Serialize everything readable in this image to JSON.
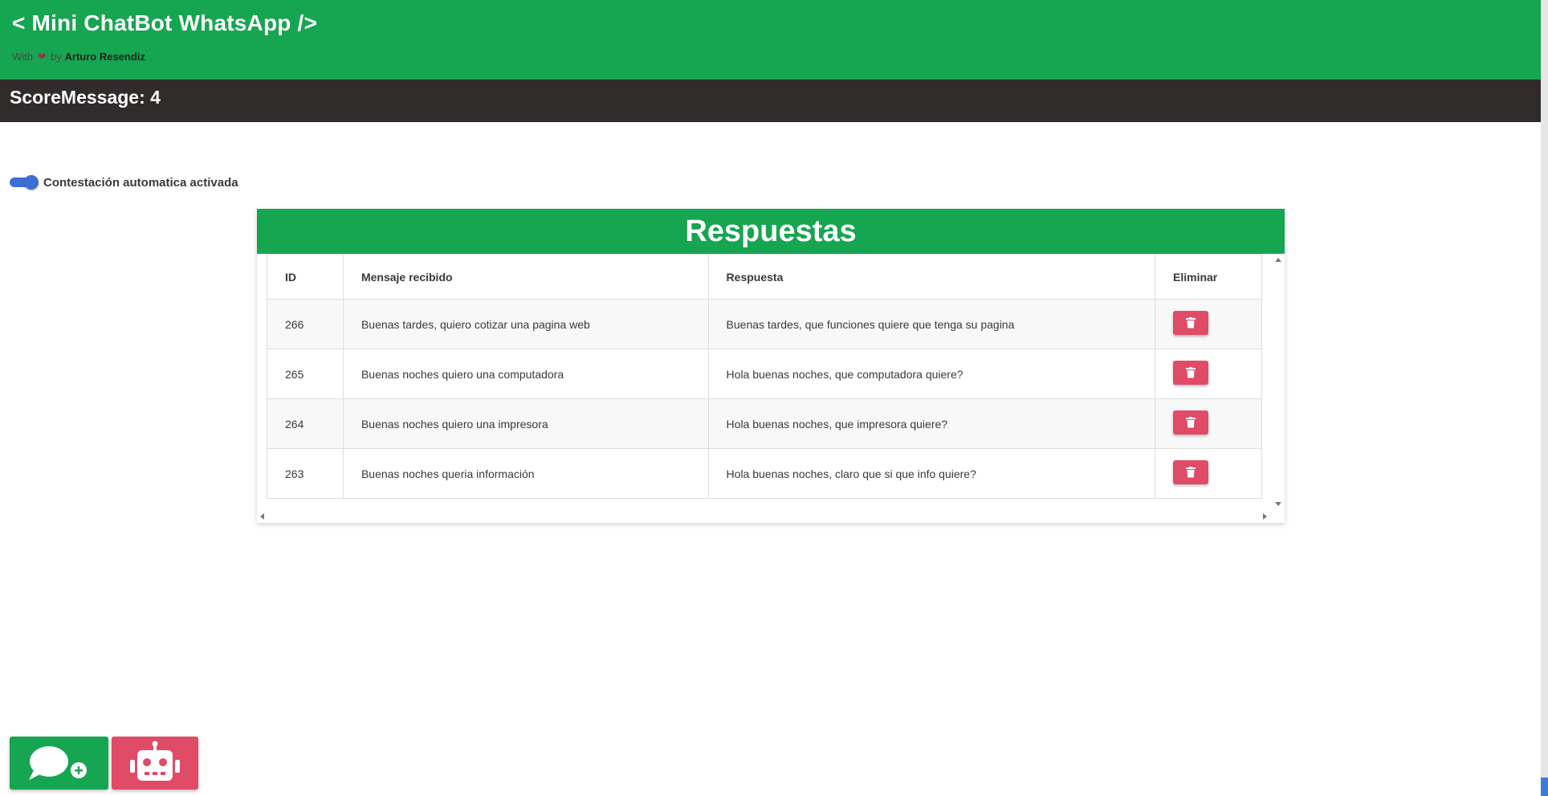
{
  "header": {
    "title": "< Mini ChatBot WhatsApp />",
    "credits_prefix": "With",
    "credits_middle": "by",
    "author": "Arturo Resendiz"
  },
  "score": {
    "text": "ScoreMessage: 4"
  },
  "auto_reply": {
    "label": "Contestación automatica activada",
    "enabled": true
  },
  "responses": {
    "title": "Respuestas",
    "columns": [
      "ID",
      "Mensaje recibido",
      "Respuesta",
      "Eliminar"
    ],
    "rows": [
      {
        "id": "266",
        "message": "Buenas tardes, quiero cotizar una pagina web",
        "response": "Buenas tardes, que funciones quiere que tenga su pagina"
      },
      {
        "id": "265",
        "message": "Buenas noches quiero una computadora",
        "response": "Hola buenas noches, que computadora quiere?"
      },
      {
        "id": "264",
        "message": "Buenas noches quiero una impresora",
        "response": "Hola buenas noches, que impresora quiere?"
      },
      {
        "id": "263",
        "message": "Buenas noches queria información",
        "response": "Hola buenas noches, claro que si que info quiere?"
      }
    ]
  },
  "colors": {
    "primary_green": "#16a550",
    "dark_bar": "#312c2c",
    "danger_pink": "#e04b67",
    "toggle_blue": "#3b6fd2"
  },
  "icons": {
    "heart": "heart-icon",
    "delete": "trash-icon",
    "new_chat": "chat-plus-icon",
    "bot": "robot-icon"
  }
}
